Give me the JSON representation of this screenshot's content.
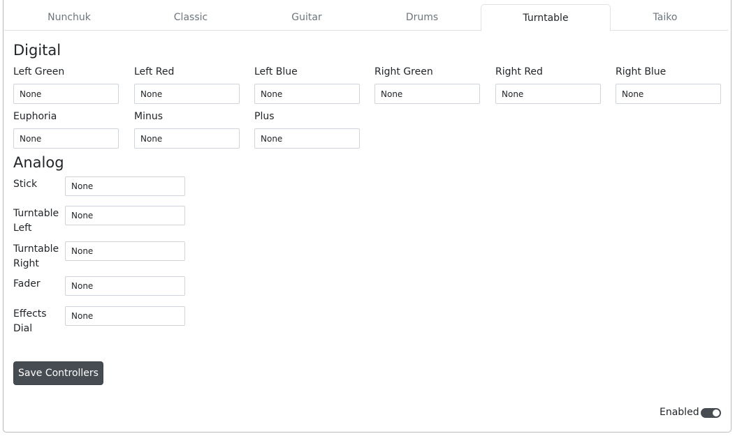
{
  "tabs": [
    {
      "label": "Nunchuk",
      "active": false
    },
    {
      "label": "Classic",
      "active": false
    },
    {
      "label": "Guitar",
      "active": false
    },
    {
      "label": "Drums",
      "active": false
    },
    {
      "label": "Turntable",
      "active": true
    },
    {
      "label": "Taiko",
      "active": false
    }
  ],
  "digital": {
    "title": "Digital",
    "fields": [
      {
        "label": "Left Green",
        "value": "None"
      },
      {
        "label": "Left Red",
        "value": "None"
      },
      {
        "label": "Left Blue",
        "value": "None"
      },
      {
        "label": "Right Green",
        "value": "None"
      },
      {
        "label": "Right Red",
        "value": "None"
      },
      {
        "label": "Right Blue",
        "value": "None"
      },
      {
        "label": "Euphoria",
        "value": "None"
      },
      {
        "label": "Minus",
        "value": "None"
      },
      {
        "label": "Plus",
        "value": "None"
      }
    ]
  },
  "analog": {
    "title": "Analog",
    "fields": [
      {
        "label": "Stick",
        "value": "None"
      },
      {
        "label": "Turntable Left",
        "value": "None"
      },
      {
        "label": "Turntable Right",
        "value": "None"
      },
      {
        "label": "Fader",
        "value": "None"
      },
      {
        "label": "Effects Dial",
        "value": "None"
      }
    ]
  },
  "actions": {
    "save_label": "Save Controllers"
  },
  "footer": {
    "enabled_label": "Enabled",
    "enabled": true
  },
  "colors": {
    "button_dark": "#474c52",
    "border": "#dee2e6"
  }
}
